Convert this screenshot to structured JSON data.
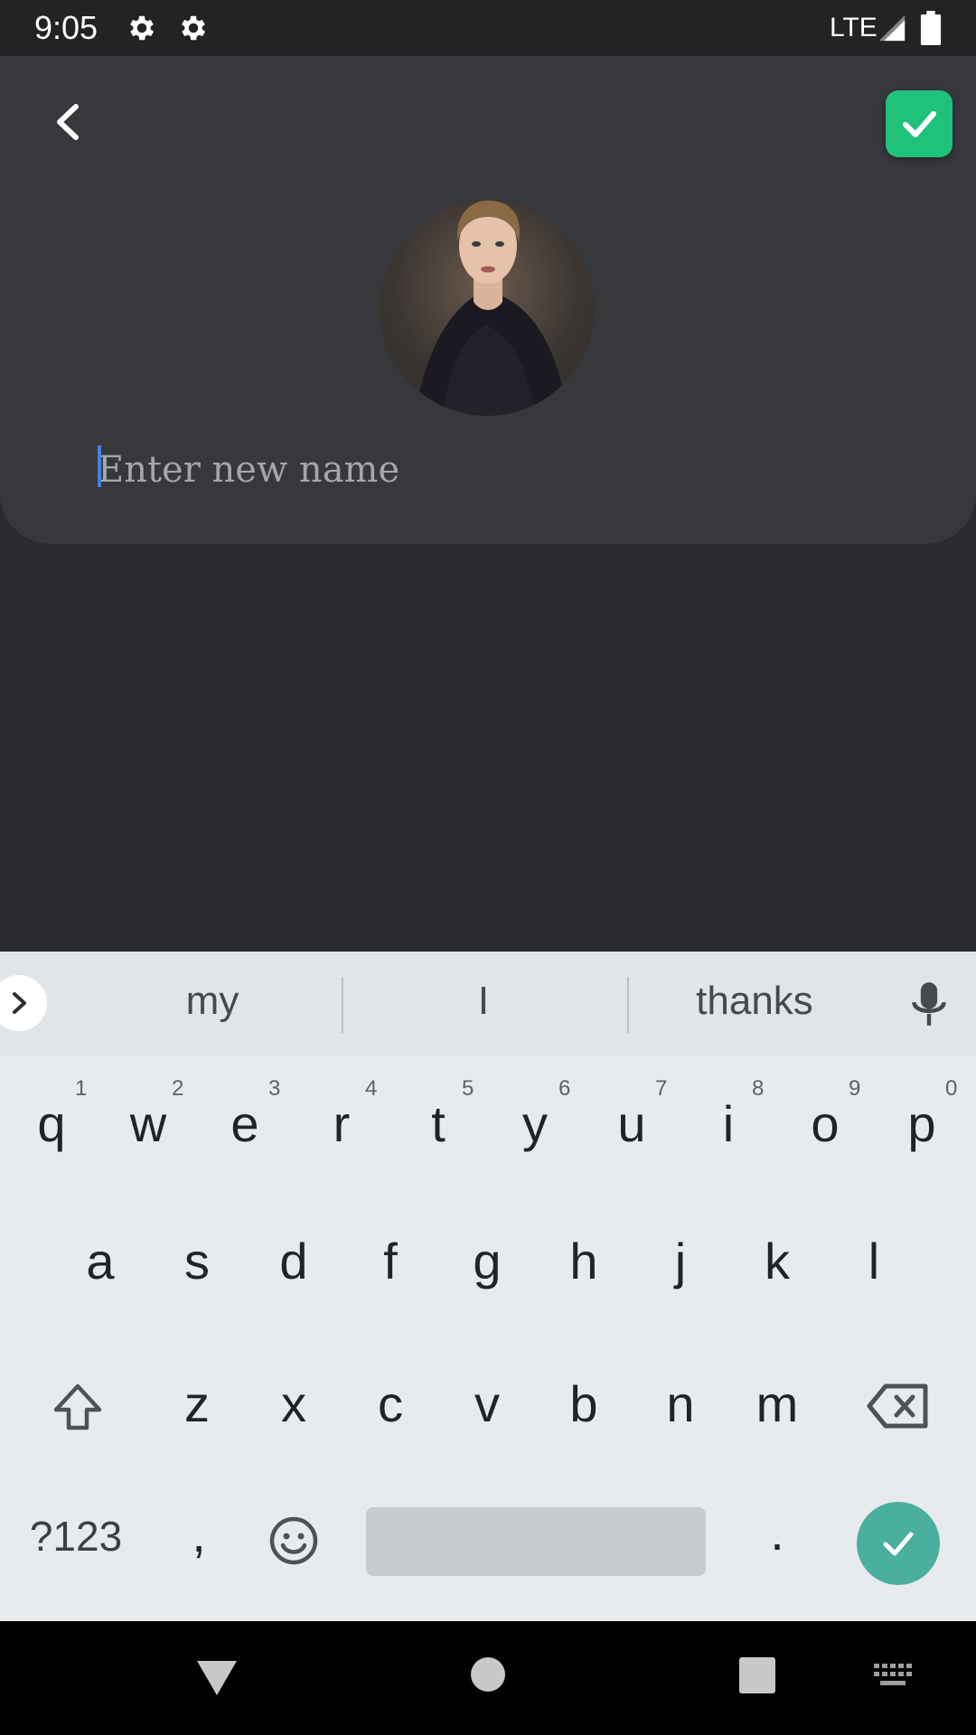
{
  "status_bar": {
    "time": "9:05",
    "network": "LTE",
    "icons": [
      "gear-icon",
      "gear-icon",
      "signal-icon",
      "battery-icon"
    ]
  },
  "header": {
    "back_icon": "chevron-left-icon",
    "confirm_icon": "check-icon",
    "confirm_color": "#1fc27a",
    "name_input": {
      "value": "",
      "placeholder": "Enter new name"
    }
  },
  "keyboard": {
    "suggestions": [
      "my",
      "I",
      "thanks"
    ],
    "row1": [
      {
        "key": "q",
        "hint": "1"
      },
      {
        "key": "w",
        "hint": "2"
      },
      {
        "key": "e",
        "hint": "3"
      },
      {
        "key": "r",
        "hint": "4"
      },
      {
        "key": "t",
        "hint": "5"
      },
      {
        "key": "y",
        "hint": "6"
      },
      {
        "key": "u",
        "hint": "7"
      },
      {
        "key": "i",
        "hint": "8"
      },
      {
        "key": "o",
        "hint": "9"
      },
      {
        "key": "p",
        "hint": "0"
      }
    ],
    "row2": [
      "a",
      "s",
      "d",
      "f",
      "g",
      "h",
      "j",
      "k",
      "l"
    ],
    "row3": [
      "z",
      "x",
      "c",
      "v",
      "b",
      "n",
      "m"
    ],
    "symbols_label": "?123",
    "comma": ",",
    "period": ".",
    "enter_color": "#4aaf9e"
  },
  "nav_bar": {
    "icons": [
      "back-triangle-icon",
      "home-circle-icon",
      "recents-square-icon",
      "keyboard-switch-icon"
    ]
  }
}
